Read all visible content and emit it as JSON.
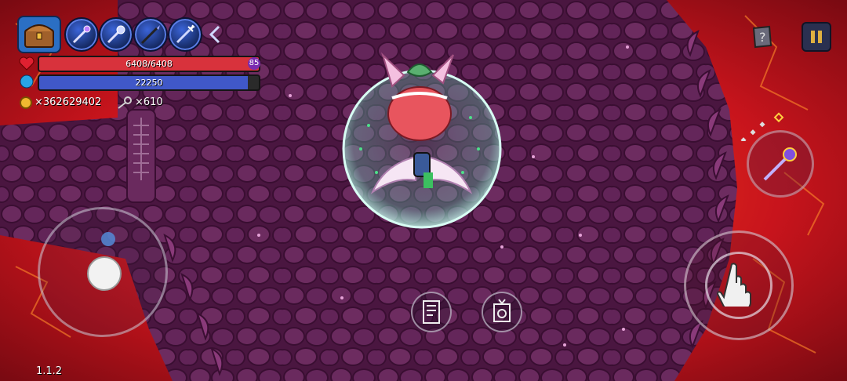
{
  "hud": {
    "health": {
      "current_text": "6408/6408",
      "fraction": 1.0,
      "color": "#d8323c"
    },
    "shield_badge": "85",
    "mana": {
      "value_text": "22250",
      "fraction": 0.95,
      "color": "#4058c8"
    },
    "coins": "×362629402",
    "keys": "×610",
    "version": "1.1.2"
  },
  "skills": [
    {
      "icon": "staff-icon"
    },
    {
      "icon": "mace-icon"
    },
    {
      "icon": "spear-icon"
    },
    {
      "icon": "trident-icon"
    }
  ],
  "icons": {
    "inventory": "treasure-chest-icon",
    "collapse": "chevron-left-icon",
    "help": "help-book-icon",
    "pause": "pause-icon",
    "weapon_switch": "mace-icon",
    "attack": "hand-pointer-icon",
    "doc": "document-icon",
    "shrine": "shrine-icon"
  },
  "colors": {
    "lava": "#c8141c",
    "floor": "#5a1f4a",
    "accent_blue": "#3b64d8"
  }
}
